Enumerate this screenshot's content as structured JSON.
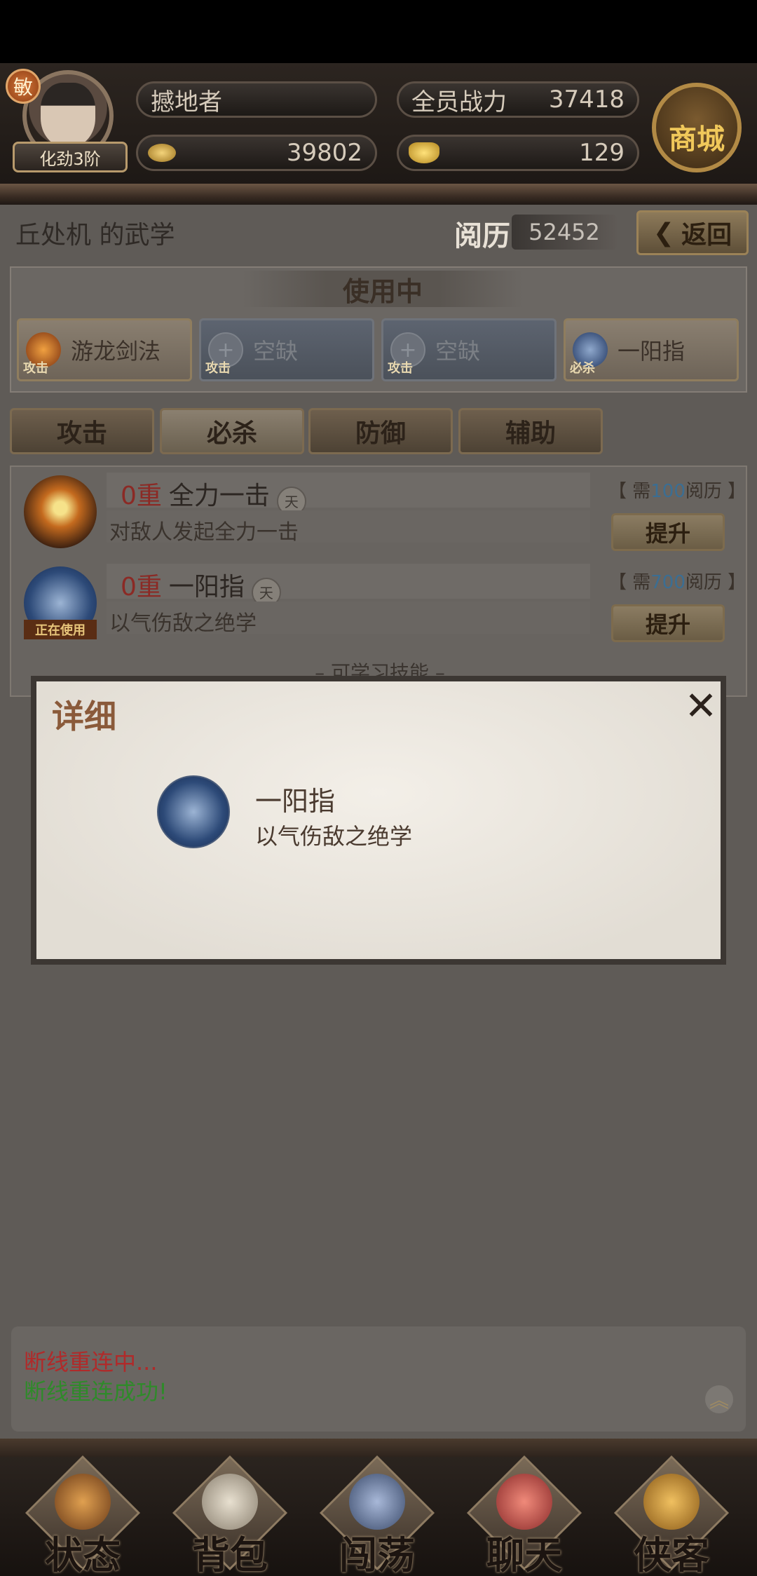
{
  "header": {
    "badge": "敏",
    "rank": "化劲3阶",
    "player_name": "撼地者",
    "power_label": "全员战力",
    "power_value": "37418",
    "coins": "39802",
    "ingots": "129",
    "shop_label": "商城"
  },
  "page": {
    "title": "丘处机 的武学",
    "exp_label": "阅历",
    "exp_value": "52452",
    "back_label": "返回"
  },
  "in_use": {
    "title": "使用中",
    "slots": [
      {
        "label": "游龙剑法",
        "tag": "攻击"
      },
      {
        "label": "空缺",
        "tag": "攻击"
      },
      {
        "label": "空缺",
        "tag": "攻击"
      },
      {
        "label": "一阳指",
        "tag": "必杀"
      }
    ]
  },
  "tabs": [
    {
      "label": "攻击"
    },
    {
      "label": "必杀"
    },
    {
      "label": "防御"
    },
    {
      "label": "辅助"
    }
  ],
  "skills": [
    {
      "level": "0重",
      "name": "全力一击",
      "tier_badge": "天",
      "desc": "对敌人发起全力一击",
      "cost_prefix": "【 需",
      "cost_num": "100",
      "cost_suffix": "阅历 】",
      "button": "提升"
    },
    {
      "level": "0重",
      "name": "一阳指",
      "tier_badge": "天",
      "desc": "以气伤敌之绝学",
      "cost_prefix": "【 需",
      "cost_num": "700",
      "cost_suffix": "阅历 】",
      "button": "提升",
      "status": "正在使用"
    }
  ],
  "learnable_label": "– 可学习技能 –",
  "modal": {
    "title": "详细",
    "close": "✕",
    "skill_name": "一阳指",
    "skill_desc": "以气伤敌之绝学"
  },
  "chat": {
    "line1": "断线重连中...",
    "line2": "断线重连成功!",
    "expand": "︽"
  },
  "bottom_nav": [
    {
      "label": "状态"
    },
    {
      "label": "背包"
    },
    {
      "label": "闯荡"
    },
    {
      "label": "聊天"
    },
    {
      "label": "侠客"
    }
  ],
  "colors": {
    "level_red": "#8b2a25",
    "cost_blue": "#3b6e93",
    "chat_red": "#b02a2a",
    "chat_green": "#2f8a2a"
  }
}
